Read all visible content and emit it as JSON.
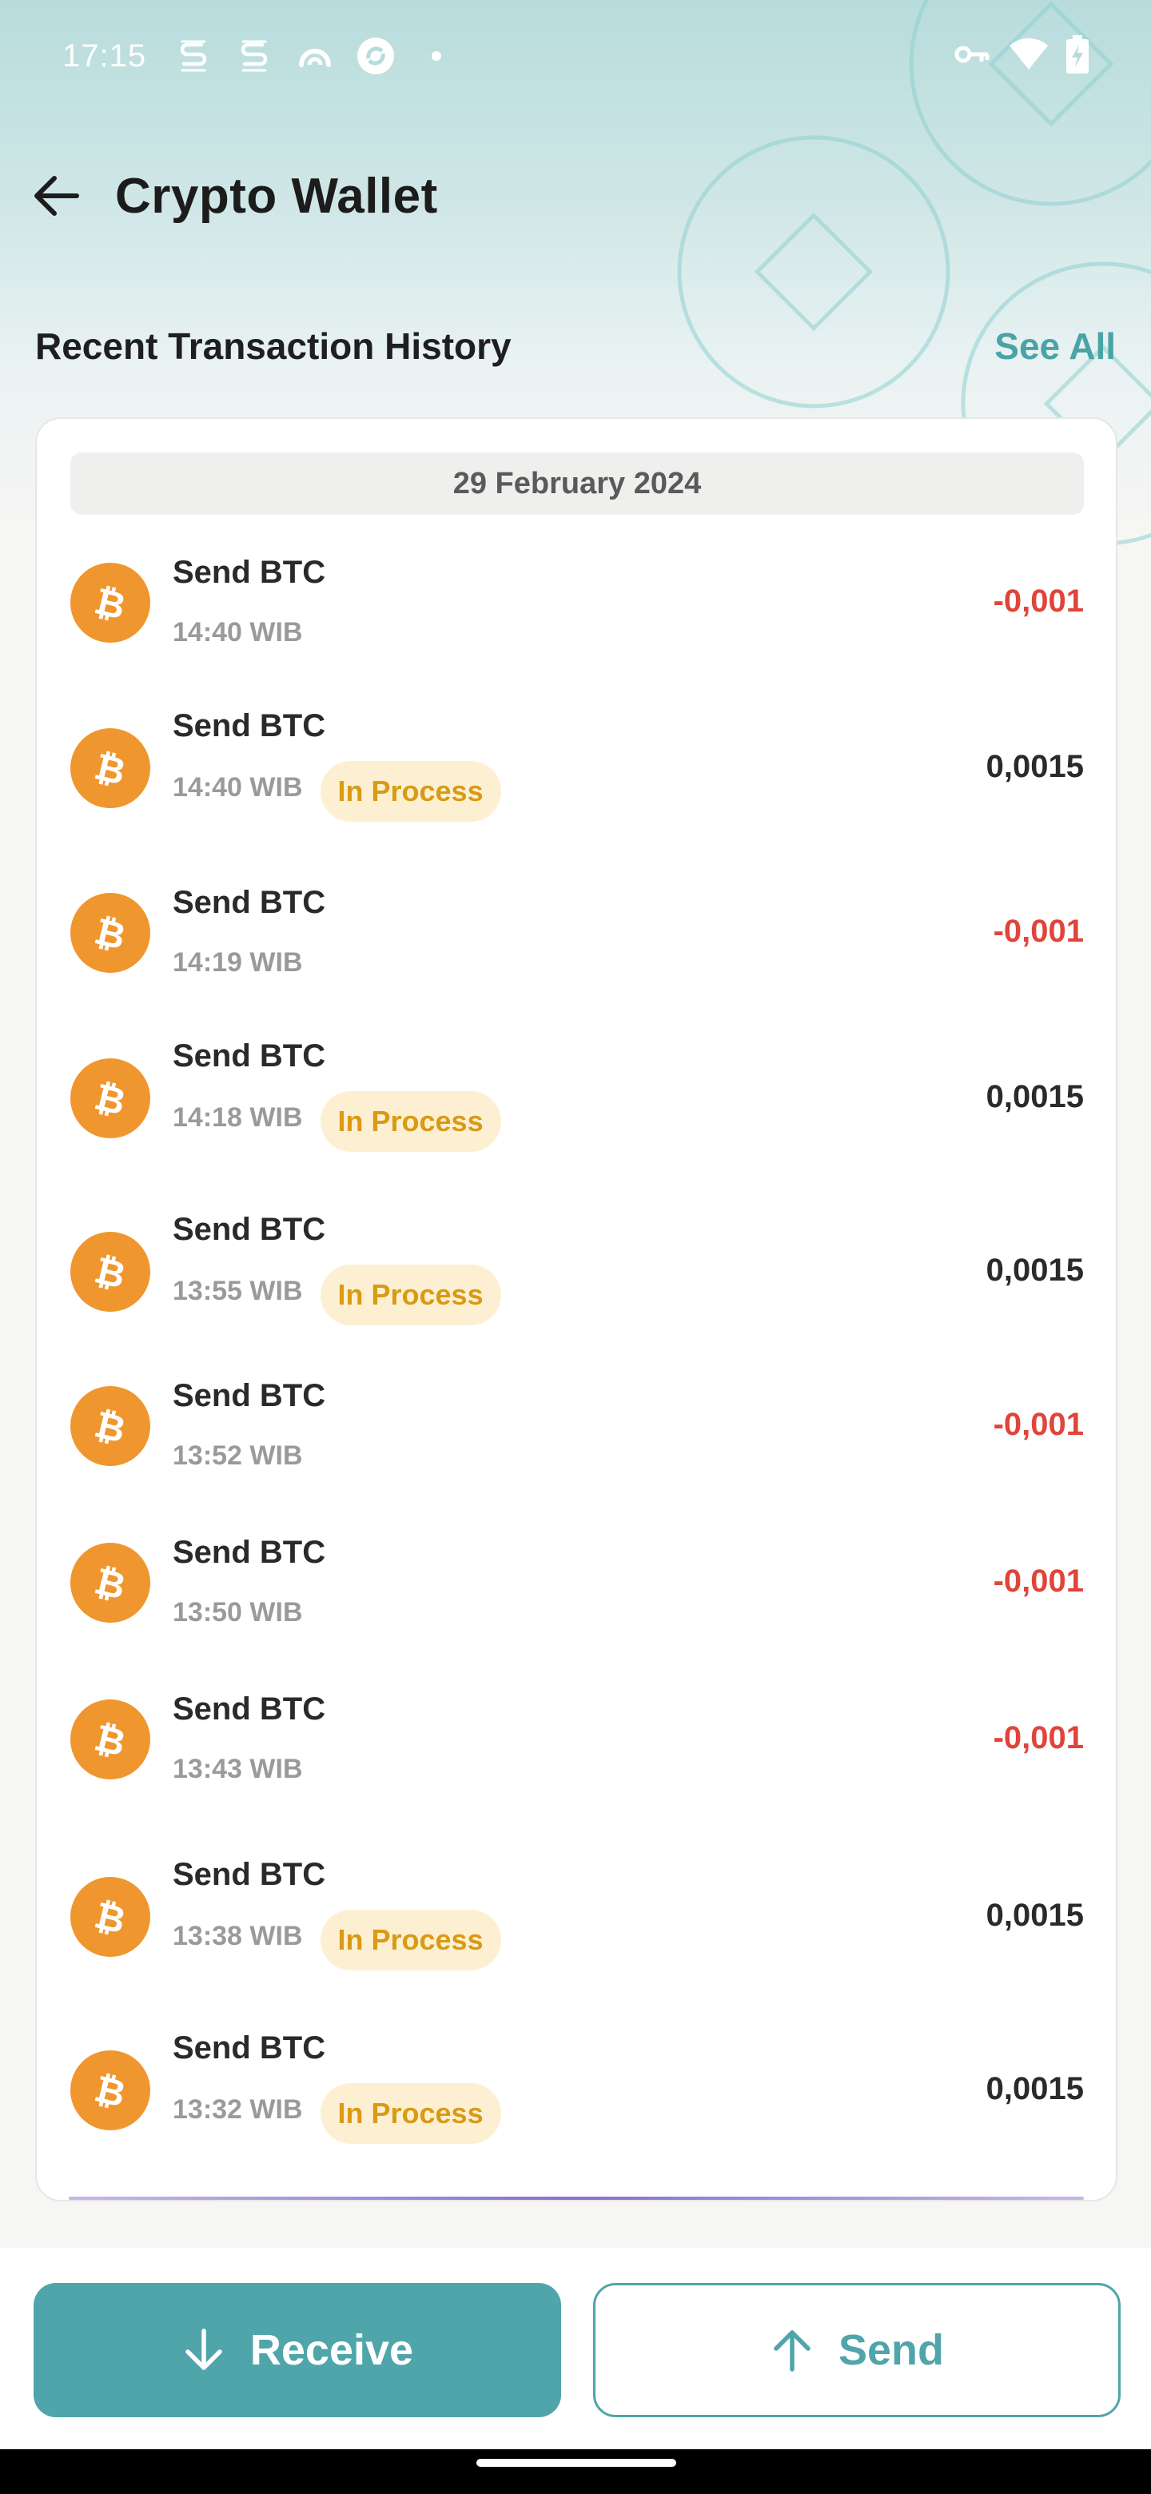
{
  "status_bar": {
    "time": "17:15",
    "left_icons": [
      "s-app-icon",
      "s-app-icon",
      "headset-icon",
      "refresh-app-icon",
      "dot-icon"
    ],
    "right_icons": [
      "vpn-key-icon",
      "wifi-icon",
      "battery-charging-icon"
    ]
  },
  "app_bar": {
    "title": "Crypto Wallet",
    "back_icon": "arrow-left-icon"
  },
  "section": {
    "title": "Recent Transaction History",
    "see_all": "See All"
  },
  "date_group": "29 February 2024",
  "transactions": [
    {
      "title": "Send BTC",
      "time": "14:40 WIB",
      "status": "",
      "amount": "-0,001",
      "direction": "out"
    },
    {
      "title": "Send BTC",
      "time": "14:40 WIB",
      "status": "In Process",
      "amount": "0,0015",
      "direction": "in"
    },
    {
      "title": "Send BTC",
      "time": "14:19 WIB",
      "status": "",
      "amount": "-0,001",
      "direction": "out"
    },
    {
      "title": "Send BTC",
      "time": "14:18 WIB",
      "status": "In Process",
      "amount": "0,0015",
      "direction": "in"
    },
    {
      "title": "Send BTC",
      "time": "13:55 WIB",
      "status": "In Process",
      "amount": "0,0015",
      "direction": "in"
    },
    {
      "title": "Send BTC",
      "time": "13:52 WIB",
      "status": "",
      "amount": "-0,001",
      "direction": "out"
    },
    {
      "title": "Send BTC",
      "time": "13:50 WIB",
      "status": "",
      "amount": "-0,001",
      "direction": "out"
    },
    {
      "title": "Send BTC",
      "time": "13:43 WIB",
      "status": "",
      "amount": "-0,001",
      "direction": "out"
    },
    {
      "title": "Send BTC",
      "time": "13:38 WIB",
      "status": "In Process",
      "amount": "0,0015",
      "direction": "in"
    },
    {
      "title": "Send BTC",
      "time": "13:32 WIB",
      "status": "In Process",
      "amount": "0,0015",
      "direction": "in"
    }
  ],
  "actions": {
    "receive_label": "Receive",
    "send_label": "Send"
  },
  "colors": {
    "accent": "#4fa5aa",
    "bitcoin": "#f0962e",
    "negative": "#e0443a",
    "badge_bg": "#fdf0d2",
    "badge_text": "#d99a14"
  }
}
